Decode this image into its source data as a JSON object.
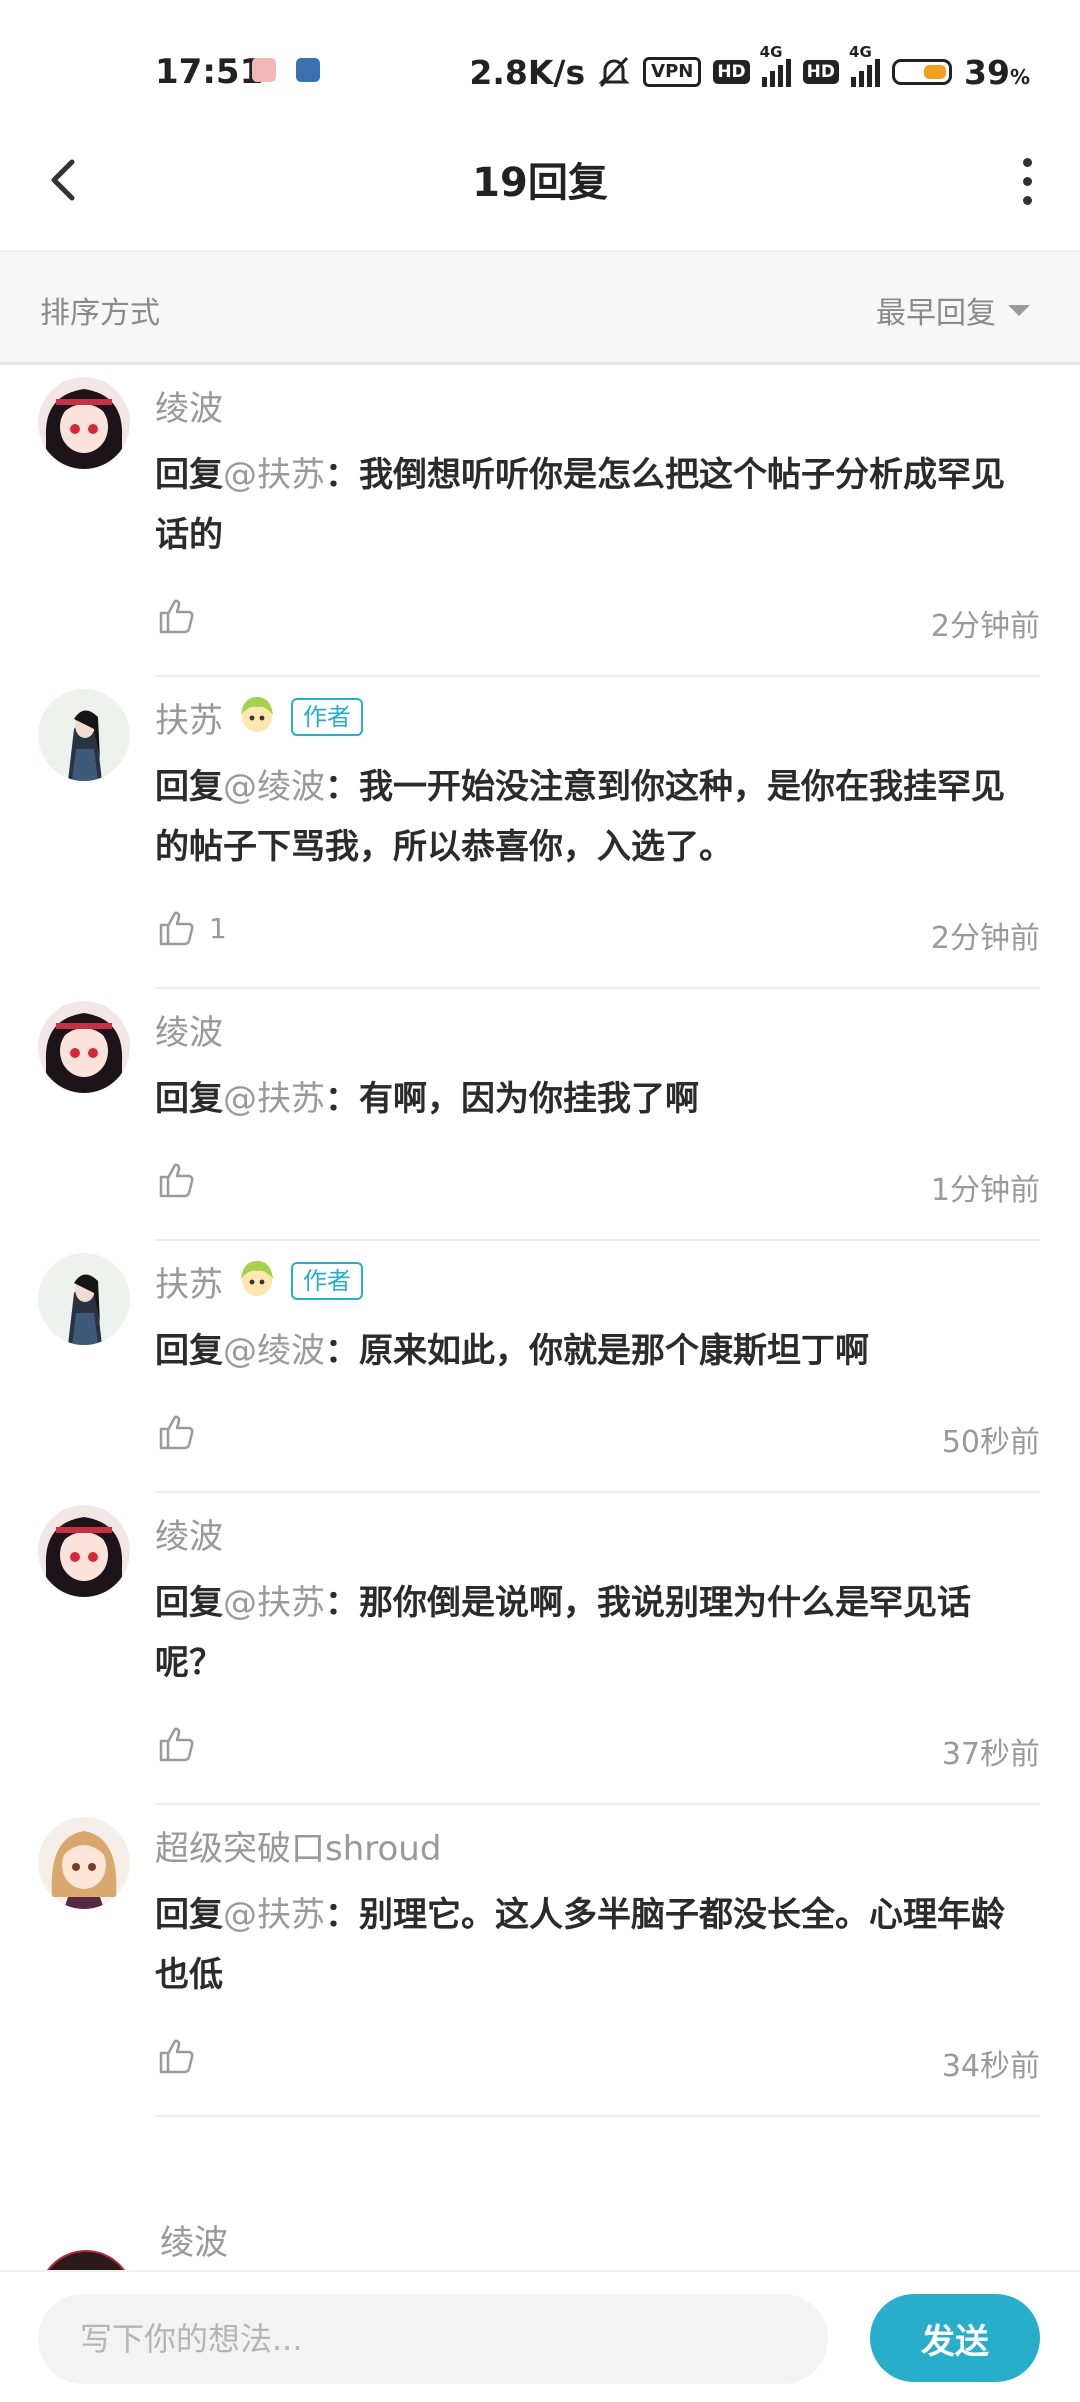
{
  "status_bar": {
    "time": "17:51",
    "network_speed": "2.8K/s",
    "vpn_label": "VPN",
    "hd_label": "HD",
    "signal_label": "4G",
    "battery_percent": "39",
    "battery_unit": "%"
  },
  "header": {
    "title": "19回复"
  },
  "sort": {
    "label": "排序方式",
    "value": "最早回复"
  },
  "author_tag": "作者",
  "reply_prefix": "回复",
  "replies": [
    {
      "name": "绫波",
      "is_author": false,
      "mention": "@扶苏",
      "text": "：我倒想听听你是怎么把这个帖子分析成罕见话的",
      "likes": "",
      "time": "2分钟前",
      "avatar": "girl-red-icon"
    },
    {
      "name": "扶苏",
      "is_author": true,
      "mention": "@绫波",
      "text": "：我一开始没注意到你这种，是你在我挂罕见的帖子下骂我，所以恭喜你，入选了。",
      "likes": "1",
      "time": "2分钟前",
      "avatar": "swordsman-icon"
    },
    {
      "name": "绫波",
      "is_author": false,
      "mention": "@扶苏",
      "text": "：有啊，因为你挂我了啊",
      "likes": "",
      "time": "1分钟前",
      "avatar": "girl-red-icon"
    },
    {
      "name": "扶苏",
      "is_author": true,
      "mention": "@绫波",
      "text": "：原来如此，你就是那个康斯坦丁啊",
      "likes": "",
      "time": "50秒前",
      "avatar": "swordsman-icon"
    },
    {
      "name": "绫波",
      "is_author": false,
      "mention": "@扶苏",
      "text": "：那你倒是说啊，我说别理为什么是罕见话呢？",
      "likes": "",
      "time": "37秒前",
      "avatar": "girl-red-icon"
    },
    {
      "name": "超级突破口shroud",
      "is_author": false,
      "mention": "@扶苏",
      "text": "：别理它。这人多半脑子都没长全。心理年龄也低",
      "likes": "",
      "time": "34秒前",
      "avatar": "anime-girl-icon"
    }
  ],
  "partial_reply": {
    "name": "绫波"
  },
  "composer": {
    "placeholder": "写下你的想法...",
    "send_label": "发送"
  },
  "colors": {
    "accent": "#28aecb",
    "muted_text": "#999999",
    "body_text": "#2b2b2b"
  }
}
